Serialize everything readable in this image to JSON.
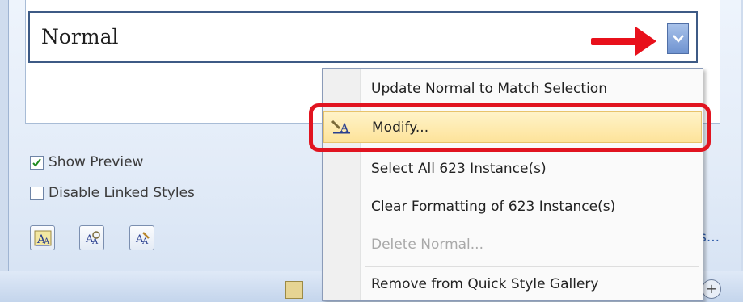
{
  "styles_pane": {
    "selected_style": "Normal",
    "show_preview": {
      "label": "Show Preview",
      "checked": true
    },
    "disable_linked_styles": {
      "label": "Disable Linked Styles",
      "checked": false
    },
    "options_link_partial": "s..."
  },
  "context_menu": {
    "items": [
      {
        "label": "Update Normal to Match Selection",
        "enabled": true
      },
      {
        "label": "Modify...",
        "enabled": true,
        "highlighted": true,
        "icon": "modify-style-icon"
      },
      {
        "label": "Select All 623 Instance(s)",
        "enabled": true
      },
      {
        "label": "Clear Formatting of 623 Instance(s)",
        "enabled": true
      },
      {
        "label": "Delete Normal...",
        "enabled": false
      },
      {
        "label": "Remove from Quick Style Gallery",
        "enabled": true
      }
    ]
  },
  "annotations": {
    "arrow_color": "#e8101b",
    "highlight_box_color": "#e11420"
  },
  "buttons": [
    {
      "name": "new-style-button",
      "icon": "new-style-icon"
    },
    {
      "name": "style-inspector-button",
      "icon": "style-inspector-icon"
    },
    {
      "name": "manage-styles-button",
      "icon": "manage-styles-icon"
    }
  ]
}
